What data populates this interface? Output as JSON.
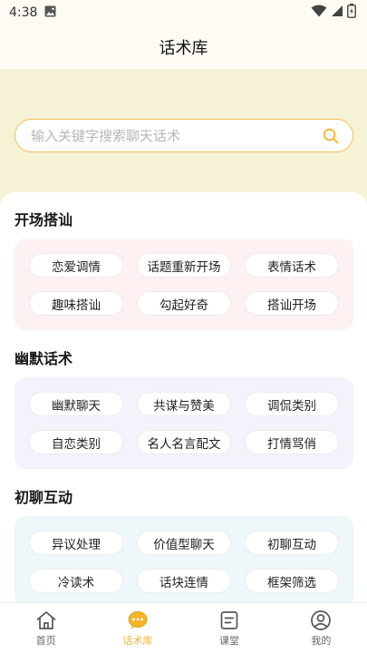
{
  "status": {
    "time": "4:38"
  },
  "header": {
    "title": "话术库"
  },
  "search": {
    "placeholder": "输入关键字搜索聊天话术"
  },
  "sections": [
    {
      "title": "开场搭讪",
      "items": [
        "恋爱调情",
        "话题重新开场",
        "表情话术",
        "趣味搭讪",
        "勾起好奇",
        "搭讪开场"
      ]
    },
    {
      "title": "幽默话术",
      "items": [
        "幽默聊天",
        "共谋与赞美",
        "调侃类别",
        "自恋类别",
        "名人名言配文",
        "打情骂俏"
      ]
    },
    {
      "title": "初聊互动",
      "items": [
        "异议处理",
        "价值型聊天",
        "初聊互动",
        "冷读术",
        "话块连情",
        "框架筛选"
      ]
    }
  ],
  "tabs": [
    {
      "label": "首页",
      "icon": "home-icon"
    },
    {
      "label": "话术库",
      "icon": "chat-bubble-icon"
    },
    {
      "label": "课堂",
      "icon": "document-icon"
    },
    {
      "label": "我的",
      "icon": "user-icon"
    }
  ],
  "colors": {
    "accent": "#f2b52c",
    "hero_bg": "#f6f2d6",
    "card1_bg": "#fdf1f2",
    "card2_bg": "#f3f3fb",
    "card3_bg": "#eef7f9"
  }
}
